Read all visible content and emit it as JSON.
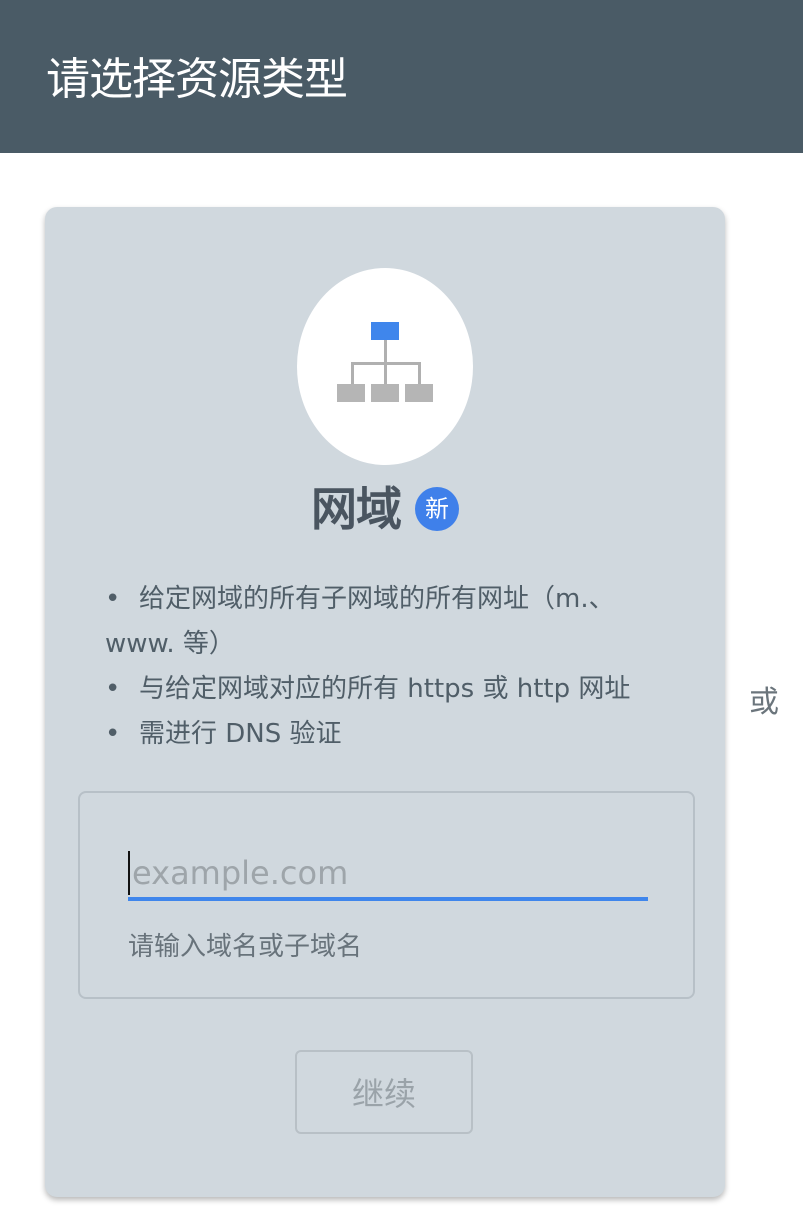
{
  "header": {
    "title": "请选择资源类型"
  },
  "card": {
    "icon": "network-hierarchy-icon",
    "title": "网域",
    "badge": "新",
    "features": [
      "给定网域的所有子网域的所有网址（m.、www. 等）",
      "与给定网域对应的所有 https 或 http 网址",
      "需进行 DNS 验证"
    ],
    "input": {
      "value": "",
      "placeholder": "example.com",
      "hint": "请输入域名或子域名"
    },
    "continue_label": "继续"
  },
  "separator": "或",
  "colors": {
    "header_bg": "#4a5b66",
    "card_bg": "#d0d8de",
    "accent": "#3f80ea"
  }
}
